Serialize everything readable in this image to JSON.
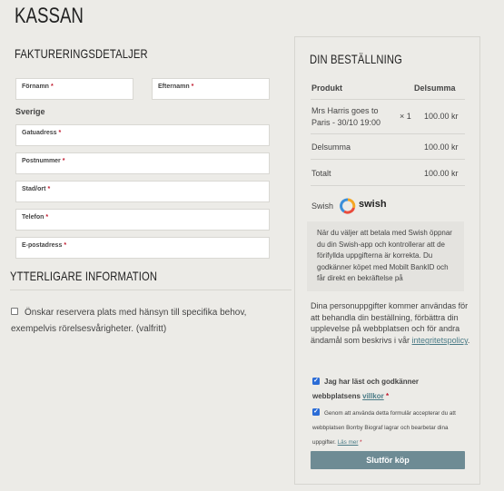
{
  "page_title": "KASSAN",
  "billing": {
    "title": "FAKTURERINGSDETALJER",
    "first_name": "Förnamn",
    "last_name": "Efternamn",
    "country": "Sverige",
    "street": "Gatuadress",
    "postcode": "Postnummer",
    "city": "Stad/ort",
    "phone": "Telefon",
    "email": "E-postadress",
    "required_mark": "*"
  },
  "additional": {
    "title": "YTTERLIGARE INFORMATION",
    "checkbox_label": "Önskar reservera plats med hänsyn till specifika behov, exempelvis rörelsesvårigheter. (valfritt)"
  },
  "order": {
    "title": "DIN BESTÄLLNING",
    "col_product": "Produkt",
    "col_subtotal": "Delsumma",
    "item_name": "Mrs Harris goes to Paris - 30/10 19:00",
    "item_qty": "× 1",
    "item_price": "100.00 kr",
    "subtotal_label": "Delsumma",
    "subtotal_value": "100.00 kr",
    "total_label": "Totalt",
    "total_value": "100.00 kr",
    "payment_method": "Swish",
    "swish_logo_text": "swish",
    "payment_notice": "När du väljer att betala med Swish öppnar du din Swish-app och kontrollerar att de förifyllda uppgifterna är korrekta. Du godkänner köpet med Mobilt BankID och får direkt en bekräftelse på",
    "privacy_text": "Dina personuppgifter kommer användas för att behandla din beställning, förbättra din upplevelse på webbplatsen och för andra ändamål som beskrivs i vår ",
    "privacy_link": "integritetspolicy",
    "privacy_end": ".",
    "terms_text": "Jag har läst och godkänner webbplatsens ",
    "terms_link": "villkor",
    "consent_text": "Genom att använda detta formulär accepterar du att webbplatsen Borrby Biograf lagrar och bearbetar dina uppgifter. ",
    "consent_link": "Läs mer",
    "submit_label": "Slutför köp",
    "colors": {
      "button": "#6e8b94",
      "link": "#4a7b86",
      "required": "#c0182c",
      "checkbox": "#2b6cd6"
    }
  }
}
